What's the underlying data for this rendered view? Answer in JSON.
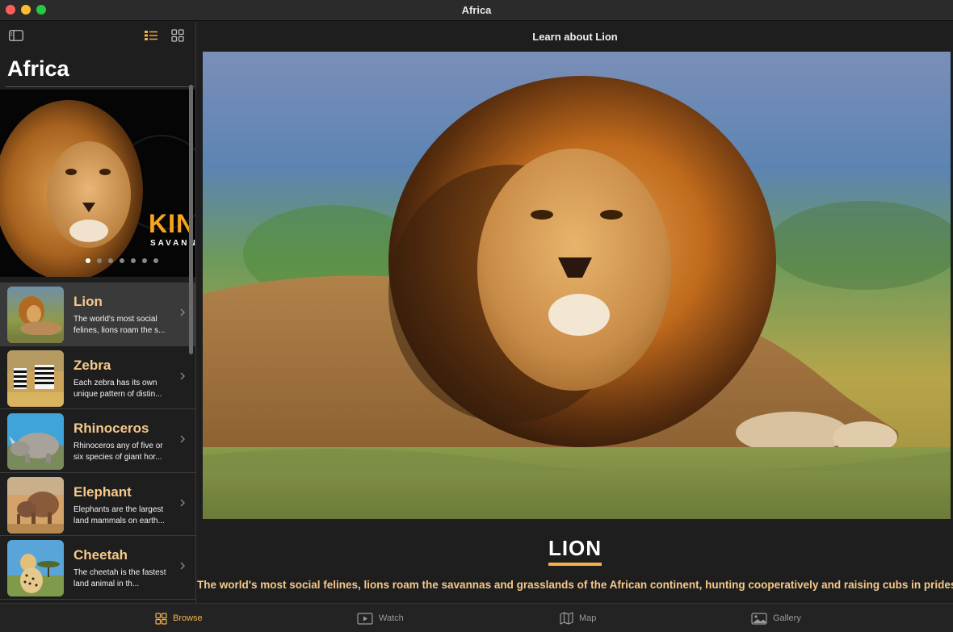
{
  "window": {
    "title": "Africa"
  },
  "sidebar": {
    "title": "Africa",
    "hero": {
      "kicker": "KIN",
      "subtitle": "SAVANN",
      "dots": 7,
      "active_dot": 0
    },
    "items": [
      {
        "name": "Lion",
        "description": "The world's most social felines, lions roam the s...",
        "selected": true
      },
      {
        "name": "Zebra",
        "description": "Each zebra has its own unique pattern of distin...",
        "selected": false
      },
      {
        "name": "Rhinoceros",
        "description": "Rhinoceros any of five or six species of giant hor...",
        "selected": false
      },
      {
        "name": "Elephant",
        "description": "Elephants are the largest land mammals on earth...",
        "selected": false
      },
      {
        "name": "Cheetah",
        "description": "The cheetah is the fastest land animal in th...",
        "selected": false
      }
    ]
  },
  "main": {
    "nav_title": "Learn about Lion",
    "heading": "LION",
    "description": "The world's most social felines, lions roam the savannas and grasslands of the African continent, hunting cooperatively and raising cubs in prides."
  },
  "tabs": [
    {
      "label": "Browse",
      "icon": "grid-icon",
      "active": true
    },
    {
      "label": "Watch",
      "icon": "play-icon",
      "active": false
    },
    {
      "label": "Map",
      "icon": "map-icon",
      "active": false
    },
    {
      "label": "Gallery",
      "icon": "photo-icon",
      "active": false
    }
  ],
  "colors": {
    "accent": "#f5b24a",
    "item_title": "#f5c98a",
    "background": "#1e1e1e"
  }
}
